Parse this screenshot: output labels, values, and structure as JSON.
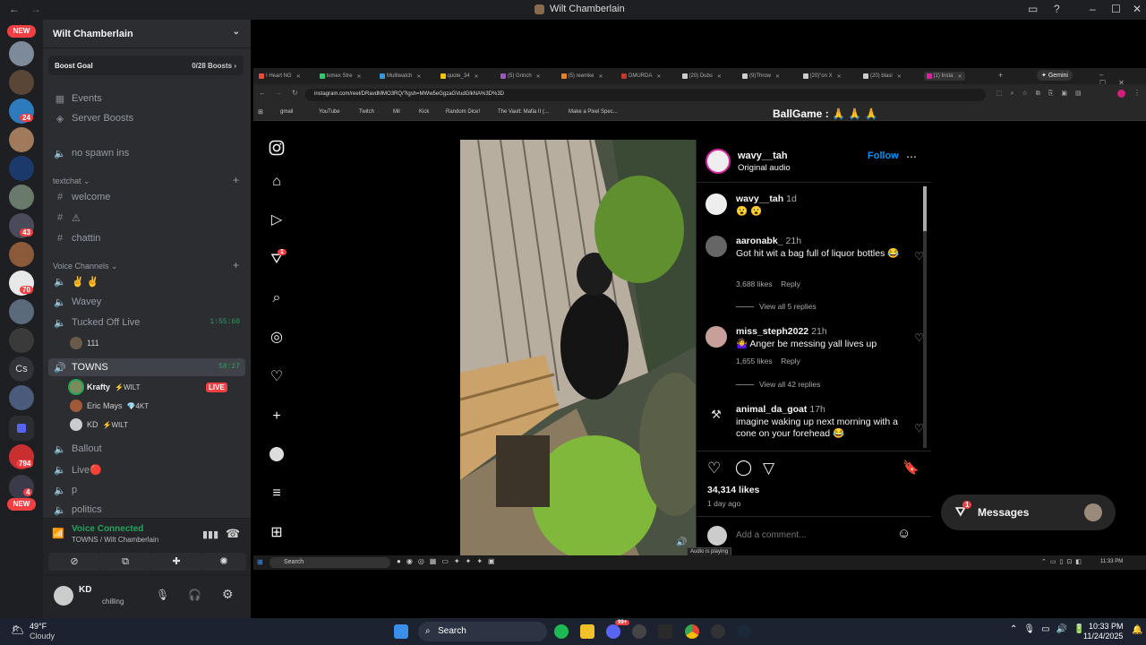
{
  "window": {
    "title": "Wilt Chamberlain"
  },
  "guilds": {
    "new_label": "NEW",
    "badges": [
      "24",
      "43",
      "70",
      "794",
      "4"
    ],
    "cs_label": "Cs"
  },
  "server": {
    "name": "Wilt Chamberlain",
    "boost_goal": "Boost Goal",
    "boost_count": "0/28 Boosts",
    "events": "Events",
    "server_boosts": "Server Boosts",
    "no_spawn": "no spawn ins",
    "textchat_cat": "textchat",
    "text_channels": [
      "welcome",
      "⚠",
      "chattin"
    ],
    "voice_cat": "Voice Channels",
    "voice_channels": {
      "v1": "✌ ✌",
      "v2": "Wavey",
      "v3": "Tucked Off Live",
      "v3_timer": "1:55:60",
      "v3_user": "111",
      "towns": "TOWNS",
      "towns_timer": "58:27",
      "users": [
        {
          "name": "Krafty",
          "tag": "⚡WILT",
          "status": "LIVE"
        },
        {
          "name": "Eric Mays",
          "tag": "💎4KT"
        },
        {
          "name": "KD",
          "tag": "⚡WILT"
        }
      ],
      "ballout": "Ballout",
      "live": "Live🔴",
      "p": "p",
      "politics": "politics"
    }
  },
  "voice_panel": {
    "status": "Voice Connected",
    "location": "TOWNS / Wilt Chamberlain"
  },
  "user_panel": {
    "name": "KD",
    "status": "chilling"
  },
  "browser": {
    "tabs": [
      "I Heart NG",
      "tomex Stre",
      "Multiwatch",
      "quote_34",
      "(5) Grinch",
      "(5) reemke",
      "DMURDA",
      "(20) Dubs",
      "(9)Throw",
      "(20)\"on X",
      "(20) blasi",
      "(1) Insta"
    ],
    "gemini": "Gemini",
    "url": "instagram.com/reel/DRavdMMO3RQ/?igsh=MWw5eGgzaGVudGlkNA%3D%3D",
    "bookmarks": [
      "gmail",
      "YouTube",
      "Twitch",
      "Mil",
      "Kick",
      "Random Dice!",
      "The Vault: Mafia II (...",
      "Make a Pixel Spec..."
    ],
    "page_overlay": "BallGame : 🙏 🙏 🙏"
  },
  "instagram": {
    "notif_count": "1",
    "author": "wavy__tah",
    "audio": "Original audio",
    "follow": "Follow",
    "comments": [
      {
        "user": "wavy__tah",
        "time": "1d",
        "text": "😮 😮"
      },
      {
        "user": "aaronabk_",
        "time": "21h",
        "text": "Got hit wit a bag full of liquor bottles 😂",
        "likes": "3,688 likes",
        "reply": "Reply",
        "view": "View all 5 replies"
      },
      {
        "user": "miss_steph2022",
        "time": "21h",
        "text": "🤷‍♀️ Anger be messing yall lives up",
        "likes": "1,655 likes",
        "reply": "Reply",
        "view": "View all 42 replies"
      },
      {
        "user": "animal_da_goat",
        "time": "17h",
        "text": "imagine waking up next morning with a cone on your forehead 😂"
      }
    ],
    "likes": "34,314 likes",
    "posted": "1 day ago",
    "add_comment": "Add a comment...",
    "messages": "Messages",
    "audio_tooltip": "Audio is playing"
  },
  "inner_taskbar": {
    "search": "Search",
    "clock": "11:33 PM"
  },
  "taskbar": {
    "weather_temp": "49°F",
    "weather_desc": "Cloudy",
    "search": "Search",
    "time": "10:33 PM",
    "date": "11/24/2025",
    "discord_badge": "99+"
  }
}
